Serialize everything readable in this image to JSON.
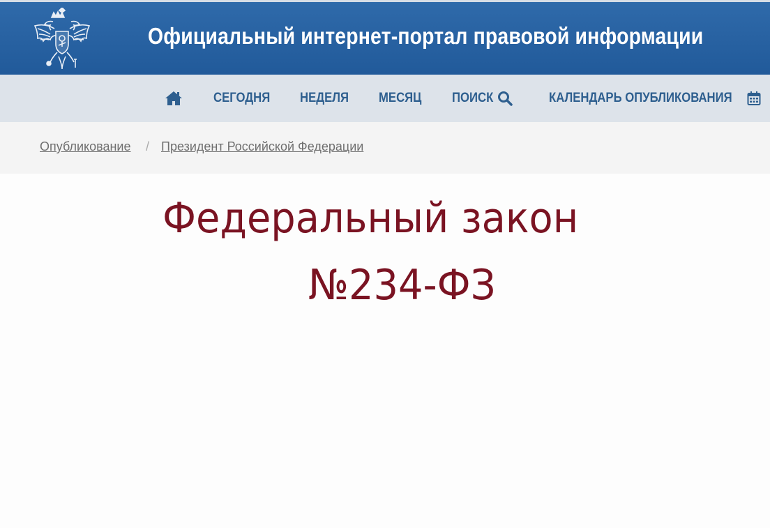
{
  "header": {
    "site_title": "Официальный интернет-портал правовой информации",
    "emblem_icon": "russian-double-headed-eagle-emblem"
  },
  "nav": {
    "home_icon": "home-icon",
    "items": [
      {
        "label": "СЕГОДНЯ"
      },
      {
        "label": "НЕДЕЛЯ"
      },
      {
        "label": "МЕСЯЦ"
      },
      {
        "label": "ПОИСК",
        "icon": "search-icon"
      },
      {
        "label": "КАЛЕНДАРЬ ОПУБЛИКОВАНИЯ",
        "icon": "calendar-icon"
      }
    ]
  },
  "breadcrumb": {
    "items": [
      {
        "label": "Опубликование"
      },
      {
        "label": "Президент Российской Федерации"
      }
    ],
    "separator": "/"
  },
  "main": {
    "title_line1": "Федеральный закон",
    "title_line2": "№234-ФЗ"
  },
  "colors": {
    "header_bg": "#2a63a3",
    "nav_bg": "#dde3ea",
    "nav_text": "#2e5f8f",
    "title_text": "#7a1322"
  }
}
